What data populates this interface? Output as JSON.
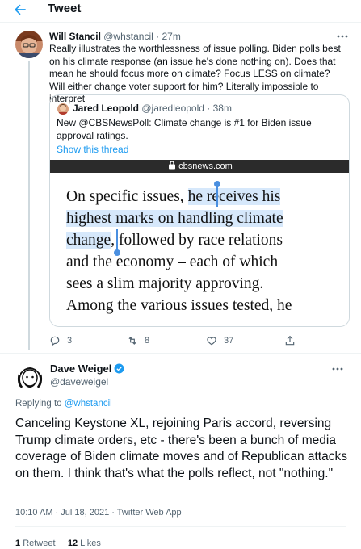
{
  "header": {
    "title": "Tweet"
  },
  "tweet1": {
    "name": "Will Stancil",
    "handle": "@whstancil",
    "separator": " · ",
    "time": "27m",
    "body": "Really illustrates the worthlessness of issue polling. Biden polls best on his climate response (an issue he's done nothing on). Does that mean he should focus more on climate? Focus LESS on climate? Will either change voter support for him? Literally impossible to interpret",
    "quote": {
      "name": "Jared Leopold",
      "handle": "@jaredleopold",
      "separator": " · ",
      "time": "38m",
      "body": "New @CBSNewsPoll: Climate change is #1 for Biden issue approval ratings.",
      "show_thread": "Show this thread",
      "image": {
        "url_label": "cbsnews.com",
        "lines": [
          {
            "pre": "On specific issues, ",
            "hl": "he receives his",
            "post": ""
          },
          {
            "pre": "",
            "hl": "highest marks on handling climate",
            "post": ""
          },
          {
            "pre": "",
            "hl": "change",
            "post": ", followed by race relations"
          },
          {
            "pre": "and the economy – each of which",
            "hl": "",
            "post": ""
          },
          {
            "pre": "sees a slim majority approving.",
            "hl": "",
            "post": ""
          },
          {
            "pre": "Among the various issues tested, he",
            "hl": "",
            "post": ""
          }
        ]
      }
    },
    "actions": {
      "replies": "3",
      "retweets": "8",
      "likes": "37"
    }
  },
  "tweet2": {
    "name": "Dave Weigel",
    "handle": "@daveweigel",
    "replying_prefix": "Replying to ",
    "replying_to": "@whstancil",
    "body": "Canceling Keystone XL, rejoining Paris accord, reversing Trump climate orders, etc - there's been a bunch of media coverage of Biden climate moves and of Republican attacks on them. I think that's what the polls reflect, not \"nothing.\"",
    "timestamp": "10:10 AM · Jul 18, 2021 · Twitter Web App",
    "stats": {
      "retweets_count": "1",
      "retweets_label": "Retweet",
      "likes_count": "12",
      "likes_label": "Likes"
    }
  },
  "colors": {
    "accent": "#1d9bf0",
    "text": "#0f1419",
    "muted": "#536471",
    "border": "#cfd9de",
    "highlight": "#d6e8fb"
  },
  "icons": {
    "back": "arrow-left-icon",
    "more": "more-dots-icon",
    "reply": "reply-icon",
    "retweet": "retweet-icon",
    "like": "heart-icon",
    "share": "share-icon",
    "verified": "verified-badge-icon",
    "lock": "lock-icon"
  }
}
